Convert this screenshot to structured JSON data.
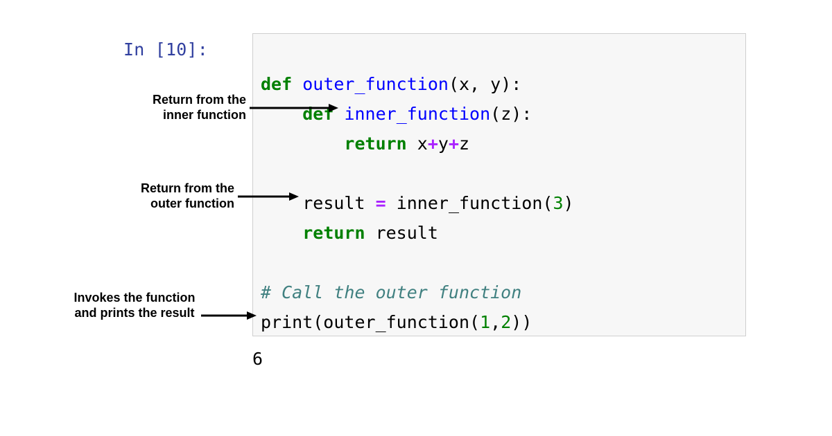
{
  "prompt": "In [10]:",
  "code": {
    "l1": {
      "def": "def",
      "name": "outer_function",
      "args": "(x, y):"
    },
    "l2": {
      "indent": "    ",
      "def": "def",
      "name": "inner_function",
      "args": "(z):"
    },
    "l3": {
      "indent": "        ",
      "ret": "return",
      "expr": " x",
      "op1": "+",
      "y": "y",
      "op2": "+",
      "z": "z"
    },
    "l4": {
      "indent": "    ",
      "lhs": "result ",
      "eq": "=",
      "call": " inner_function(",
      "arg": "3",
      "close": ")"
    },
    "l5": {
      "indent": "    ",
      "ret": "return",
      "rest": " result"
    },
    "l6": {
      "comment": "# Call the outer function"
    },
    "l7": {
      "call1": "print(outer_function(",
      "a1": "1",
      "comma": ",",
      "a2": "2",
      "close": "))"
    }
  },
  "output": "6",
  "annotations": {
    "a1": "Return from the inner function",
    "a2": "Return from the outer function",
    "a3": "Invokes the function and prints the result"
  }
}
